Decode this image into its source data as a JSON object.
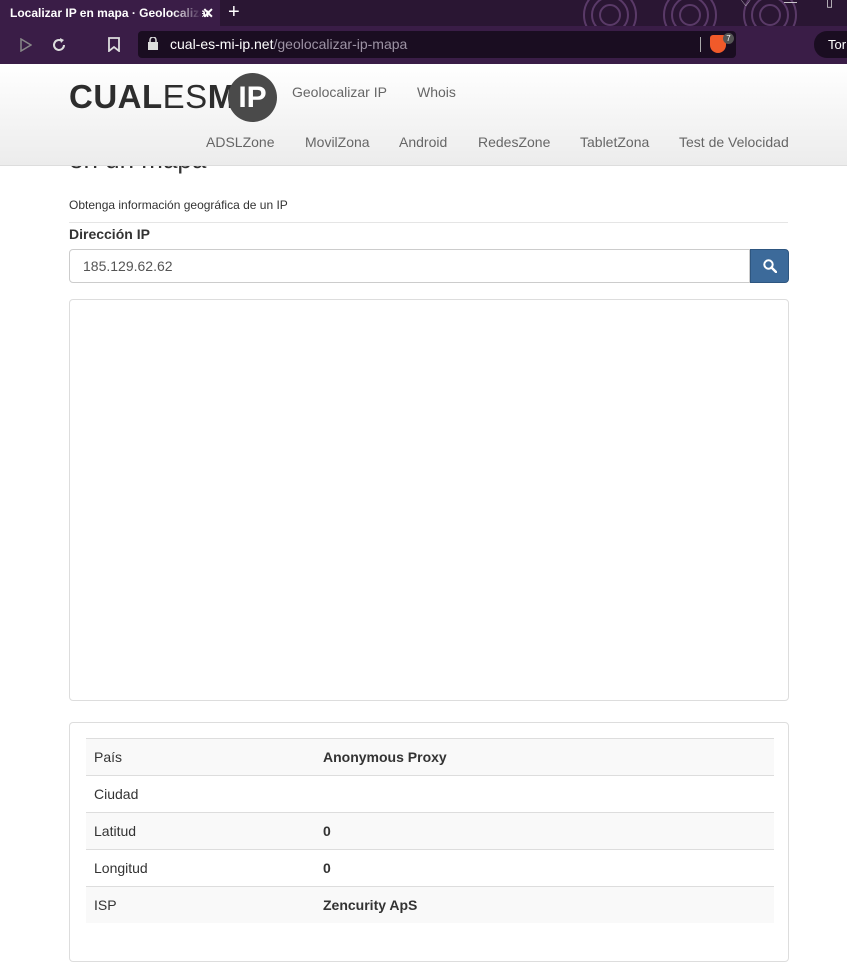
{
  "browser": {
    "tab_title": "Localizar IP en mapa · Geolocalizar",
    "tab_close": "✕",
    "new_tab": "+",
    "url_domain": "cual-es-mi-ip.net",
    "url_path": "/geolocalizar-ip-mapa",
    "shield_count": "7",
    "tor_label": "Tor"
  },
  "site": {
    "logo_bold": "CUAL",
    "logo_es": "ES",
    "logo_mi": "MI",
    "logo_ip": "IP",
    "nav_primary": [
      "Geolocalizar IP",
      "Whois"
    ],
    "nav_secondary": [
      "ADSLZone",
      "MovilZona",
      "Android",
      "RedesZone",
      "TabletZona",
      "Test de Velocidad"
    ]
  },
  "page": {
    "heading_partial": "en un mapa",
    "subtitle": "Obtenga información geográfica de un IP",
    "ip_label": "Dirección IP",
    "ip_value": "185.129.62.62"
  },
  "info": {
    "rows": [
      {
        "label": "País",
        "value": "Anonymous Proxy"
      },
      {
        "label": "Ciudad",
        "value": ""
      },
      {
        "label": "Latitud",
        "value": "0"
      },
      {
        "label": "Longitud",
        "value": "0"
      },
      {
        "label": "ISP",
        "value": "Zencurity ApS"
      }
    ]
  },
  "colors": {
    "browser_frame": "#3a1d47",
    "search_button": "#3c6a9a"
  },
  "icons": [
    "back-icon",
    "forward-icon",
    "reload-icon",
    "bookmark-icon",
    "lock-icon",
    "brave-shield-icon",
    "search-icon",
    "close-icon",
    "plus-icon"
  ]
}
